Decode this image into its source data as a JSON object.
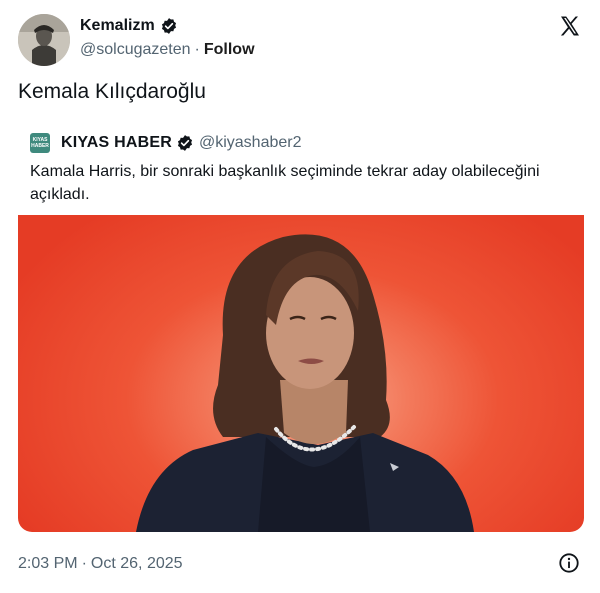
{
  "author": {
    "name": "Kemalizm",
    "handle": "@solcugazeten",
    "separator": "·",
    "follow_label": "Follow"
  },
  "tweet": {
    "text": "Kemala Kılıçdaroğlu"
  },
  "quote": {
    "avatar_line1": "KIYAS",
    "avatar_line2": "HABER",
    "name": "KIYAS HABER",
    "handle": "@kiyashaber2",
    "text": "Kamala Harris, bir sonraki başkanlık seçiminde tekrar aday olabileceğini açıkladı."
  },
  "footer": {
    "time": "2:03 PM",
    "separator": "·",
    "date": "Oct 26, 2025"
  },
  "icons": {
    "verified": "verified-badge-icon",
    "x_logo": "x-logo-icon",
    "info": "info-icon"
  },
  "colors": {
    "text": "#0f1419",
    "secondary_text": "#536471",
    "image_background": "#ee5436"
  }
}
